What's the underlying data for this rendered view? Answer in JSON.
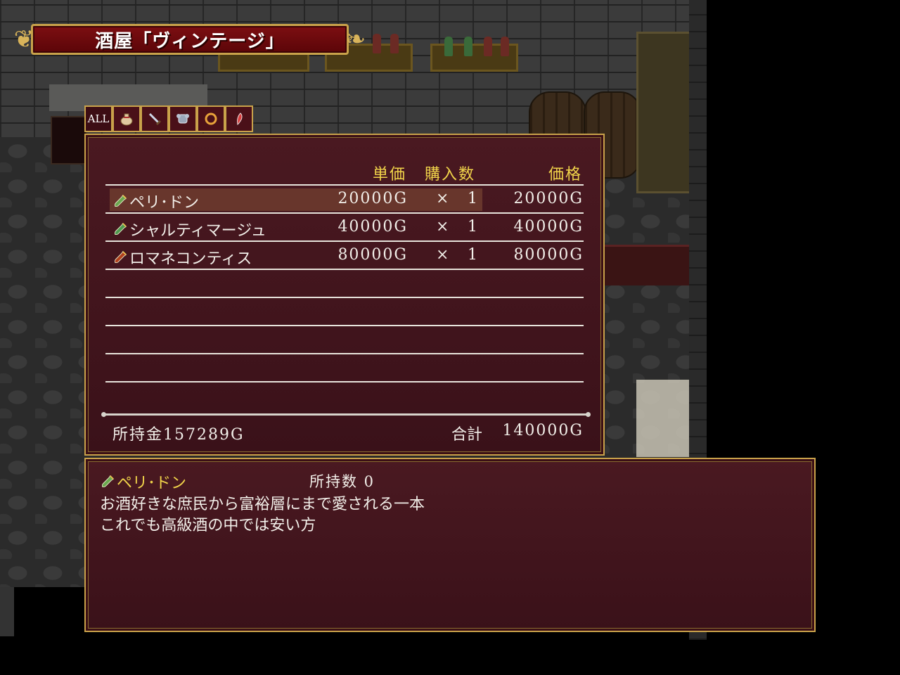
{
  "shop_title": "酒屋「ヴィンテージ」",
  "tabs": [
    {
      "label": "ALL",
      "icon": "all-icon"
    },
    {
      "label": "",
      "icon": "pouch-icon"
    },
    {
      "label": "",
      "icon": "sword-icon"
    },
    {
      "label": "",
      "icon": "armor-icon"
    },
    {
      "label": "",
      "icon": "ring-icon"
    },
    {
      "label": "",
      "icon": "feather-icon"
    }
  ],
  "table": {
    "headers": {
      "unit_price": "単価",
      "quantity": "購入数",
      "price": "価格"
    },
    "items": [
      {
        "name": "ペリ･ドン",
        "unit_price": "20000G",
        "times": "×",
        "qty": "1",
        "total": "20000G",
        "icon": "wine-bottle-icon",
        "selected": true
      },
      {
        "name": "シャルティマージュ",
        "unit_price": "40000G",
        "times": "×",
        "qty": "1",
        "total": "40000G",
        "icon": "wine-bottle-icon",
        "selected": false
      },
      {
        "name": "ロマネコンティス",
        "unit_price": "80000G",
        "times": "×",
        "qty": "1",
        "total": "80000G",
        "icon": "wine-bottle-icon",
        "selected": false
      }
    ]
  },
  "footer": {
    "money": "所持金157289G",
    "sum_label": "合計",
    "sum_value": "140000G"
  },
  "help": {
    "item_name": "ペリ･ドン",
    "owned": "所持数 0",
    "desc_line1": "お酒好きな庶民から富裕層にまで愛される一本",
    "desc_line2": "これでも高級酒の中では安い方"
  },
  "colors": {
    "window_bg": "#3f141c",
    "frame_gold": "#c9a24a",
    "header_yellow": "#f1d44a",
    "title_red": "#7d0f12"
  }
}
